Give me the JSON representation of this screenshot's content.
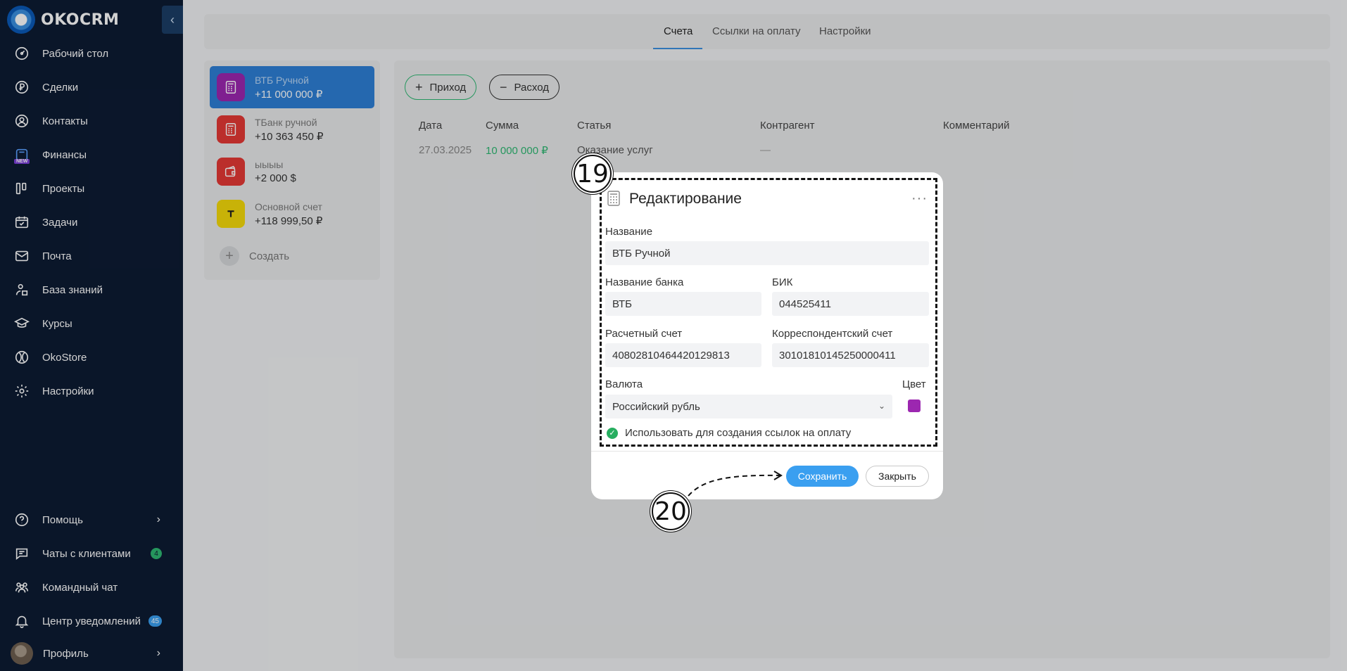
{
  "app": {
    "name": "OKOCRM"
  },
  "sidebar": {
    "collapse_glyph": "‹",
    "items": [
      {
        "label": "Рабочий стол",
        "icon": "dashboard-icon"
      },
      {
        "label": "Сделки",
        "icon": "ruble-icon"
      },
      {
        "label": "Контакты",
        "icon": "contact-icon"
      },
      {
        "label": "Финансы",
        "icon": "finance-icon",
        "tag": "NEW"
      },
      {
        "label": "Проекты",
        "icon": "projects-icon"
      },
      {
        "label": "Задачи",
        "icon": "calendar-icon"
      },
      {
        "label": "Почта",
        "icon": "mail-icon"
      },
      {
        "label": "База знаний",
        "icon": "knowledge-icon"
      },
      {
        "label": "Курсы",
        "icon": "courses-icon"
      },
      {
        "label": "OkoStore",
        "icon": "store-icon"
      },
      {
        "label": "Настройки",
        "icon": "gear-icon"
      }
    ],
    "bottom": [
      {
        "label": "Помощь",
        "icon": "help-icon"
      },
      {
        "label": "Чаты с клиентами",
        "icon": "chat-icon",
        "badge": "4"
      },
      {
        "label": "Командный чат",
        "icon": "team-icon"
      },
      {
        "label": "Центр уведомлений",
        "icon": "bell-icon",
        "badge": "45"
      },
      {
        "label": "Профиль",
        "icon": "avatar"
      }
    ]
  },
  "tabs": [
    "Счета",
    "Ссылки на оплату",
    "Настройки"
  ],
  "accounts": [
    {
      "name": "ВТБ Ручной",
      "amount": "+11 000 000 ₽",
      "color": "#9c27b0"
    },
    {
      "name": "ТБанк ручной",
      "amount": "+10 363 450 ₽",
      "color": "#e53935"
    },
    {
      "name": "ыыыы",
      "amount": "+2 000 $",
      "color": "#e53935"
    },
    {
      "name": "Основной счет",
      "amount": "+118 999,50 ₽",
      "color": "#f5d90a"
    }
  ],
  "create_label": "Создать",
  "actions": {
    "income": "Приход",
    "expense": "Расход"
  },
  "table": {
    "headers": [
      "Дата",
      "Сумма",
      "Статья",
      "Контрагент",
      "Комментарий"
    ],
    "rows": [
      [
        "27.03.2025",
        "10 000 000 ₽",
        "Оказание услуг",
        "—",
        ""
      ]
    ]
  },
  "modal": {
    "title": "Редактирование",
    "menu_glyph": "···",
    "name_label": "Название",
    "name_value": "ВТБ Ручной",
    "bank_label": "Название банка",
    "bank_value": "ВТБ",
    "bik_label": "БИК",
    "bik_value": "044525411",
    "account_label": "Расчетный счет",
    "account_value": "40802810464420129813",
    "corr_label": "Корреспондентский счет",
    "corr_value": "30101810145250000411",
    "currency_label": "Валюта",
    "currency_value": "Российский рубль",
    "color_label": "Цвет",
    "color_value": "#9c27b0",
    "payment_links_label": "Использовать для создания ссылок на оплату",
    "payment_links_checked": true,
    "save": "Сохранить",
    "close": "Закрыть"
  },
  "annotations": {
    "step_a": "19",
    "step_b": "20"
  },
  "colors": {
    "sidebar_bg": "#0d1b33",
    "accent": "#3a9ff0",
    "amount_green": "#2eb872"
  }
}
